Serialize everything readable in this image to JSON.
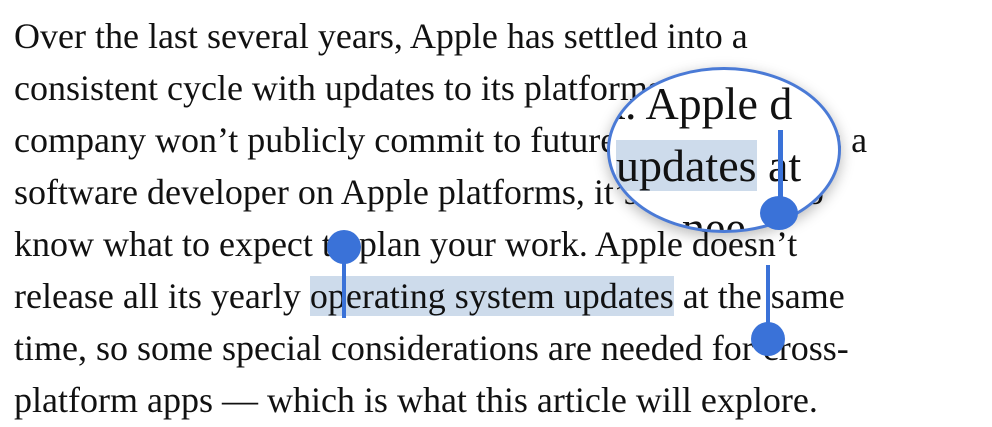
{
  "article": {
    "lines": [
      "Over the last several years, Apple has settled into a",
      "consistent cycle with updates to its platforms. The",
      "company won’t publicly commit to future features, but as a",
      "software developer on Apple platforms, it’s important to",
      "know what to expect to plan your work. Apple doesn’t",
      {
        "before": "release all its yearly ",
        "selected": "operating system updates",
        "after": " at the same"
      },
      "time, so some special considerations are needed for cross-",
      "platform apps — which is what this article will explore."
    ]
  },
  "magnifier": {
    "line_above": "k. Apple d",
    "selected": "updates",
    "after": " at",
    "line_below": "e nee"
  },
  "colors": {
    "selection_highlight": "#cddbeb",
    "handle": "#3a72d8",
    "loupe_border": "#4a7ad6"
  }
}
